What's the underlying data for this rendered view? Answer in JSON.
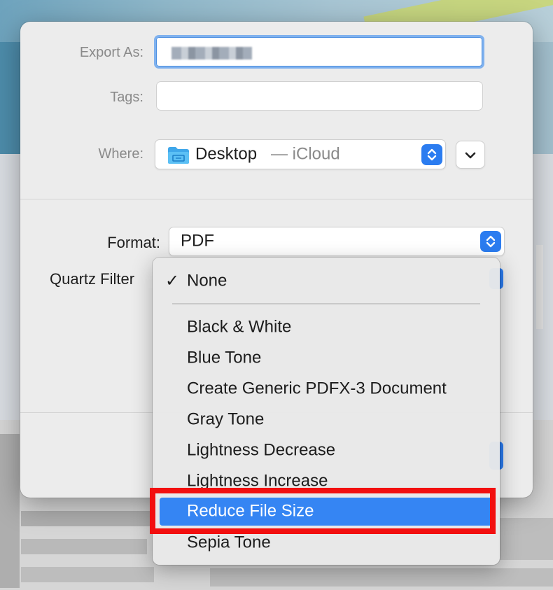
{
  "dialog": {
    "export_as_label": "Export As:",
    "tags_label": "Tags:",
    "where_label": "Where:",
    "where_location": "Desktop",
    "where_cloud": "— iCloud",
    "format_label": "Format:",
    "format_value": "PDF",
    "quartz_filter_label": "Quartz Filter"
  },
  "menu": {
    "checkmark": "✓",
    "selected_checked": "None",
    "items": [
      "Black & White",
      "Blue Tone",
      "Create Generic PDFX-3 Document",
      "Gray Tone",
      "Lightness Decrease",
      "Lightness Increase",
      "Reduce File Size",
      "Sepia Tone"
    ],
    "highlighted": "Reduce File Size"
  },
  "colors": {
    "accent_blue": "#2b7cf0",
    "highlight_red": "#f20f0f",
    "menu_selected": "#3585f3"
  }
}
